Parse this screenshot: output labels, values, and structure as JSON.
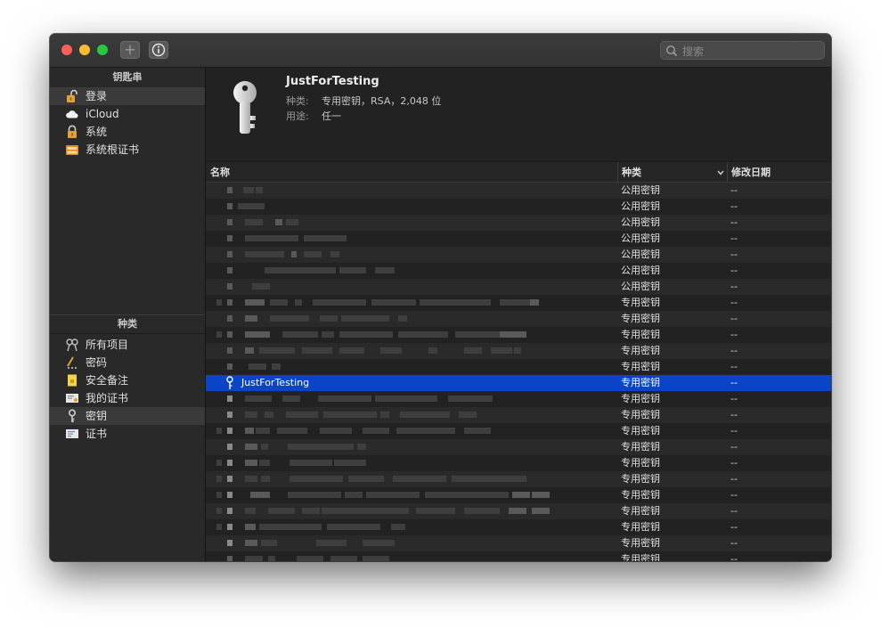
{
  "toolbar": {
    "add_label": "+",
    "info_label": "i",
    "search_placeholder": "搜索",
    "search_value": ""
  },
  "sidebar": {
    "keychains_header": "钥匙串",
    "keychains": [
      {
        "label": "登录",
        "icon": "padlock-open-icon",
        "selected": true
      },
      {
        "label": "iCloud",
        "icon": "cloud-icon",
        "selected": false
      },
      {
        "label": "系统",
        "icon": "padlock-icon",
        "selected": false
      },
      {
        "label": "系统根证书",
        "icon": "cabinet-icon",
        "selected": false
      }
    ],
    "category_header": "种类",
    "categories": [
      {
        "label": "所有项目",
        "icon": "all-items-icon",
        "selected": false
      },
      {
        "label": "密码",
        "icon": "password-icon",
        "selected": false
      },
      {
        "label": "安全备注",
        "icon": "secure-note-icon",
        "selected": false
      },
      {
        "label": "我的证书",
        "icon": "my-certificate-icon",
        "selected": false
      },
      {
        "label": "密钥",
        "icon": "key-icon",
        "selected": true
      },
      {
        "label": "证书",
        "icon": "certificate-icon",
        "selected": false
      }
    ]
  },
  "info": {
    "title": "JustForTesting",
    "kind_key": "种类:",
    "kind_value": "专用密钥，RSA，2,048 位",
    "usage_key": "用途:",
    "usage_value": "任一"
  },
  "table": {
    "columns": {
      "name": "名称",
      "kind": "种类",
      "date": "修改日期"
    },
    "rows": [
      {
        "kind": "公用密钥",
        "date": "--"
      },
      {
        "kind": "公用密钥",
        "date": "--"
      },
      {
        "kind": "公用密钥",
        "date": "--"
      },
      {
        "kind": "公用密钥",
        "date": "--"
      },
      {
        "kind": "公用密钥",
        "date": "--"
      },
      {
        "kind": "公用密钥",
        "date": "--"
      },
      {
        "kind": "公用密钥",
        "date": "--"
      },
      {
        "kind": "专用密钥",
        "date": "--"
      },
      {
        "kind": "专用密钥",
        "date": "--"
      },
      {
        "kind": "专用密钥",
        "date": "--"
      },
      {
        "kind": "专用密钥",
        "date": "--"
      },
      {
        "kind": "专用密钥",
        "date": "--"
      },
      {
        "name": "JustForTesting",
        "kind": "专用密钥",
        "date": "--",
        "selected": true
      },
      {
        "kind": "专用密钥",
        "date": "--"
      },
      {
        "kind": "专用密钥",
        "date": "--"
      },
      {
        "kind": "专用密钥",
        "date": "--"
      },
      {
        "kind": "专用密钥",
        "date": "--"
      },
      {
        "kind": "专用密钥",
        "date": "--"
      },
      {
        "kind": "专用密钥",
        "date": "--"
      },
      {
        "kind": "专用密钥",
        "date": "--"
      },
      {
        "kind": "专用密钥",
        "date": "--"
      },
      {
        "kind": "专用密钥",
        "date": "--"
      },
      {
        "kind": "专用密钥",
        "date": "--"
      },
      {
        "kind": "专用密钥",
        "date": "--"
      }
    ]
  },
  "colors": {
    "selection": "#0a45c8",
    "window_bg": "#222222"
  }
}
